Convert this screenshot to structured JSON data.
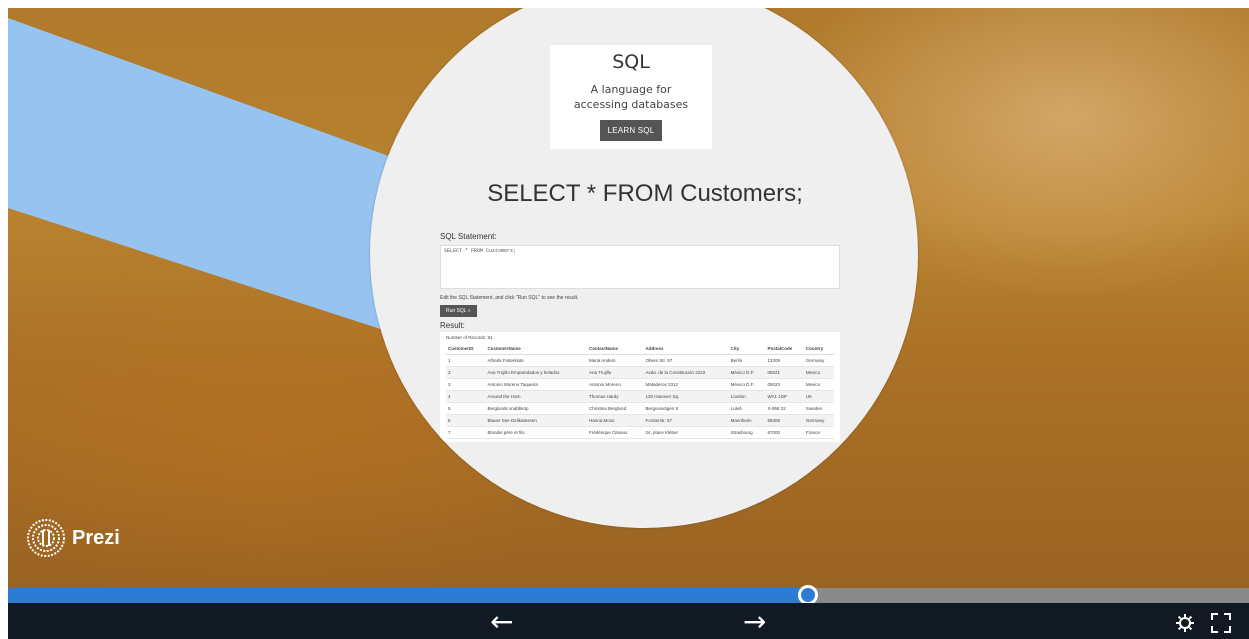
{
  "presentation": {
    "card": {
      "title": "SQL",
      "subtitle": "A language for accessing databases",
      "button": "LEARN SQL"
    },
    "query": "SELECT * FROM Customers;",
    "tryit": {
      "statement_label": "SQL Statement:",
      "statement_value": "SELECT * FROM Customers;",
      "instruction": "Edit the SQL Statement, and click \"Run SQL\" to see the result.",
      "run_button": "Run SQL »",
      "result_label": "Result:",
      "records": "Number of Records: 91",
      "columns": [
        "CustomerID",
        "CustomerName",
        "ContactName",
        "Address",
        "City",
        "PostalCode",
        "Country"
      ],
      "rows": [
        [
          "1",
          "Alfreds Futterkiste",
          "Maria Anders",
          "Obere Str. 57",
          "Berlin",
          "12209",
          "Germany"
        ],
        [
          "2",
          "Ana Trujillo Emparedados y helados",
          "Ana Trujillo",
          "Avda. de la Constitución 2222",
          "México D.F.",
          "05021",
          "Mexico"
        ],
        [
          "3",
          "Antonio Moreno Taquería",
          "Antonio Moreno",
          "Mataderos 2312",
          "México D.F.",
          "05023",
          "Mexico"
        ],
        [
          "4",
          "Around the Horn",
          "Thomas Hardy",
          "120 Hanover Sq.",
          "London",
          "WA1 1DP",
          "UK"
        ],
        [
          "5",
          "Berglunds snabbköp",
          "Christina Berglund",
          "Berguvsvägen 8",
          "Luleå",
          "S-958 22",
          "Sweden"
        ],
        [
          "6",
          "Blauer See Delikatessen",
          "Hanna Moos",
          "Forsterstr. 57",
          "Mannheim",
          "68306",
          "Germany"
        ],
        [
          "7",
          "Blondel père et fils",
          "Frédérique Citeaux",
          "24, place Kléber",
          "Strasbourg",
          "67000",
          "France"
        ]
      ]
    }
  },
  "branding": {
    "logo_text": "Prezi",
    "logo_icon": "prezi-logo-icon"
  },
  "player": {
    "progress": 0.645,
    "prev_icon": "←",
    "next_icon": "→",
    "settings_icon": "gear-icon",
    "fullscreen_icon": "fullscreen-icon"
  },
  "colors": {
    "accent": "#2e7bd3",
    "band": "#96c3f0",
    "bar": "#111a23"
  }
}
